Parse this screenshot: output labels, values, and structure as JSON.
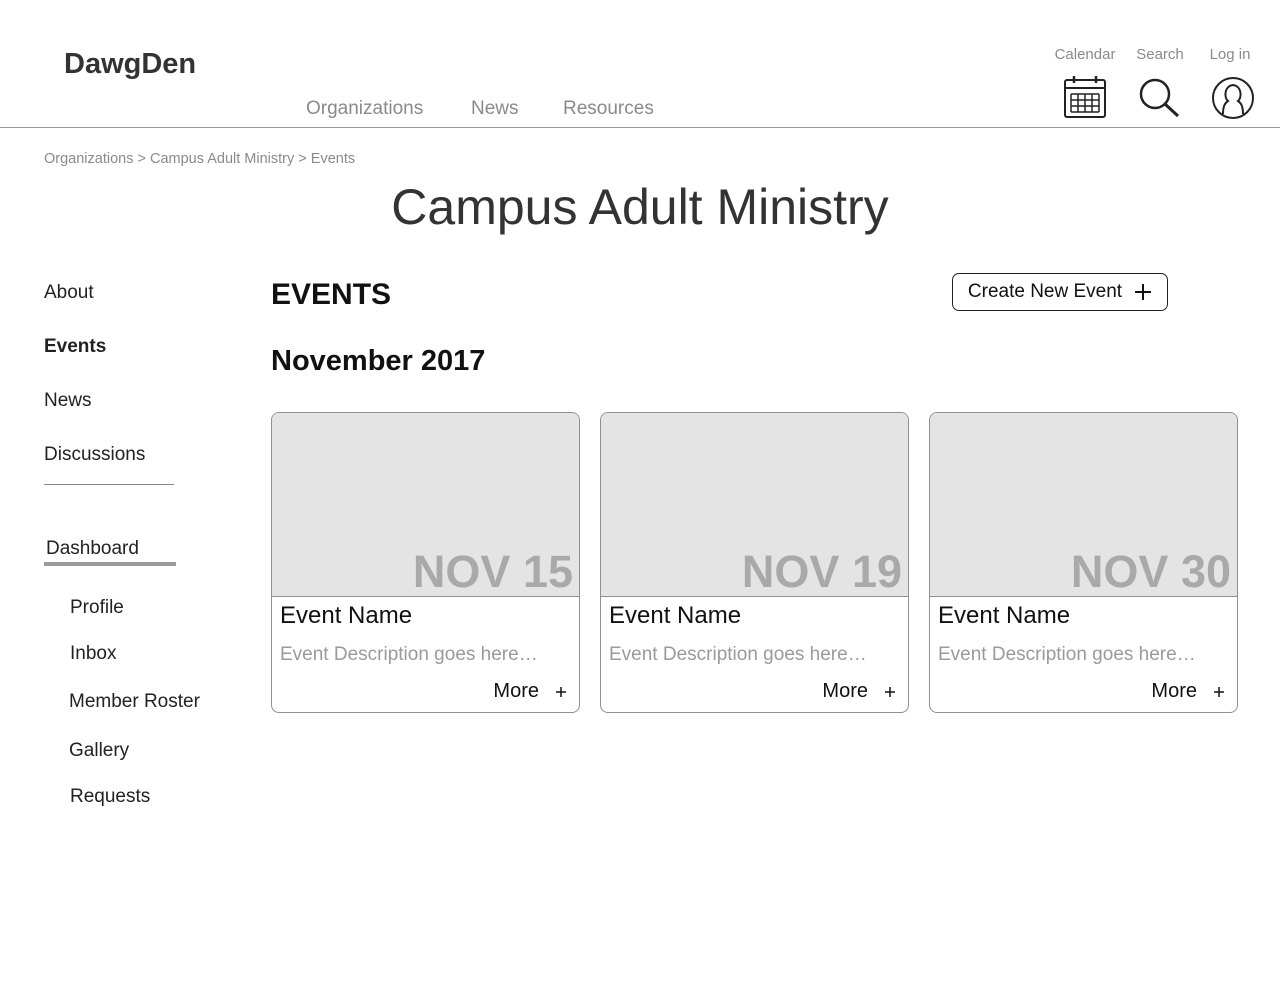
{
  "header": {
    "logo": "DawgDen",
    "nav": [
      "Organizations",
      "News",
      "Resources"
    ],
    "utilities": [
      {
        "label": "Calendar",
        "icon": "calendar-icon"
      },
      {
        "label": "Search",
        "icon": "search-icon"
      },
      {
        "label": "Log in",
        "icon": "user-icon"
      }
    ]
  },
  "breadcrumb": {
    "items": [
      "Organizations",
      "Campus Adult Ministry",
      "Events"
    ],
    "separator": ">"
  },
  "page_title": "Campus Adult Ministry",
  "sidebar": {
    "items": [
      {
        "label": "About"
      },
      {
        "label": "Events",
        "active": true
      },
      {
        "label": "News"
      },
      {
        "label": "Discussions"
      }
    ],
    "dashboard_label": "Dashboard",
    "dashboard_items": [
      "Profile",
      "Inbox",
      "Member Roster",
      "Gallery",
      "Requests"
    ]
  },
  "main": {
    "section_title": "EVENTS",
    "create_button_label": "Create New Event",
    "create_button_icon": "plus-icon",
    "month_title": "November 2017",
    "events": [
      {
        "date": "NOV 15",
        "name": "Event Name",
        "description": "Event Description goes here…",
        "more_label": "More"
      },
      {
        "date": "NOV 19",
        "name": "Event Name",
        "description": "Event Description goes here…",
        "more_label": "More"
      },
      {
        "date": "NOV 30",
        "name": "Event Name",
        "description": "Event Description goes here…",
        "more_label": "More"
      }
    ]
  },
  "colors": {
    "muted_text": "#8a8a8a",
    "card_image_bg": "#e4e4e4",
    "date_text": "#a9a9a9"
  }
}
